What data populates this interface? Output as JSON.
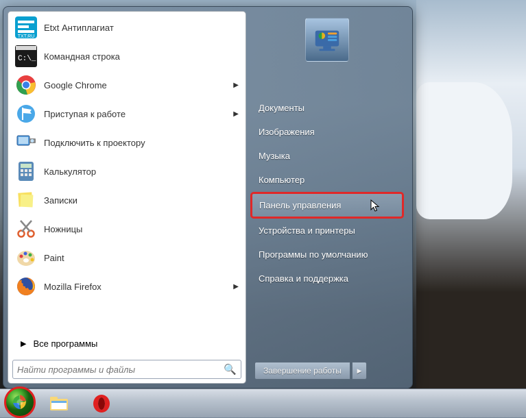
{
  "programs": [
    {
      "label": "Etxt Антиплагиат",
      "icon": "etxt",
      "expandable": false
    },
    {
      "label": "Командная строка",
      "icon": "cmd",
      "expandable": false
    },
    {
      "label": "Google Chrome",
      "icon": "chrome",
      "expandable": true
    },
    {
      "label": "Приступая к работе",
      "icon": "flag",
      "expandable": true
    },
    {
      "label": "Подключить к проектору",
      "icon": "projector",
      "expandable": false
    },
    {
      "label": "Калькулятор",
      "icon": "calc",
      "expandable": false
    },
    {
      "label": "Записки",
      "icon": "notes",
      "expandable": false
    },
    {
      "label": "Ножницы",
      "icon": "snip",
      "expandable": false
    },
    {
      "label": "Paint",
      "icon": "paint",
      "expandable": false
    },
    {
      "label": "Mozilla Firefox",
      "icon": "firefox",
      "expandable": true
    }
  ],
  "all_programs_label": "Все программы",
  "search_placeholder": "Найти программы и файлы",
  "right_items": [
    {
      "label": "Документы",
      "highlighted": false
    },
    {
      "label": "Изображения",
      "highlighted": false
    },
    {
      "label": "Музыка",
      "highlighted": false
    },
    {
      "label": "Компьютер",
      "highlighted": false
    },
    {
      "label": "Панель управления",
      "highlighted": true
    },
    {
      "label": "Устройства и принтеры",
      "highlighted": false
    },
    {
      "label": "Программы по умолчанию",
      "highlighted": false
    },
    {
      "label": "Справка и поддержка",
      "highlighted": false
    }
  ],
  "shutdown_label": "Завершение работы",
  "taskbar": {
    "pinned": [
      {
        "name": "explorer"
      },
      {
        "name": "opera"
      }
    ]
  },
  "colors": {
    "highlight_border": "#e02828"
  }
}
